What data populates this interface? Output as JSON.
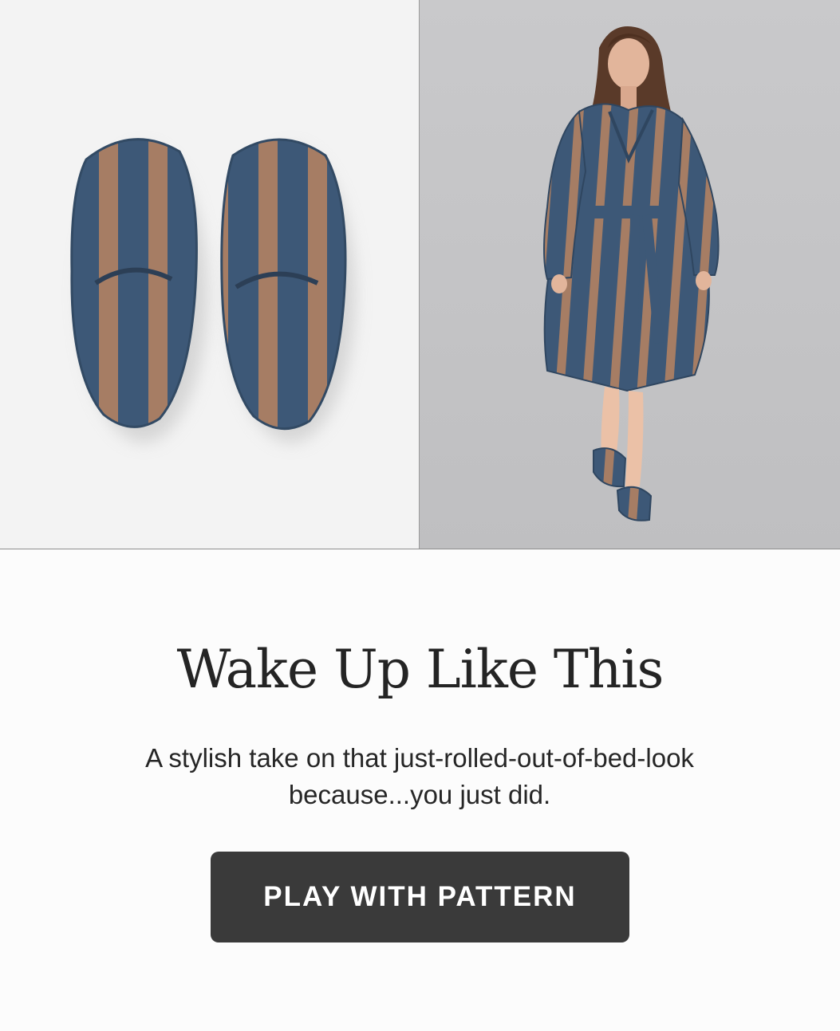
{
  "hero": {
    "left_image": "striped-terry-slippers-photo",
    "right_image": "striped-terry-robe-model-photo"
  },
  "colors": {
    "stripe_navy": "#3d5877",
    "stripe_tan": "#a67d64",
    "button_bg": "#3a3a3a",
    "headline": "#242424"
  },
  "promo": {
    "headline": "Wake Up Like This",
    "subtext": "A stylish take on that just-rolled-out-of-bed-look because...you just did.",
    "cta_label": "PLAY WITH PATTERN"
  }
}
